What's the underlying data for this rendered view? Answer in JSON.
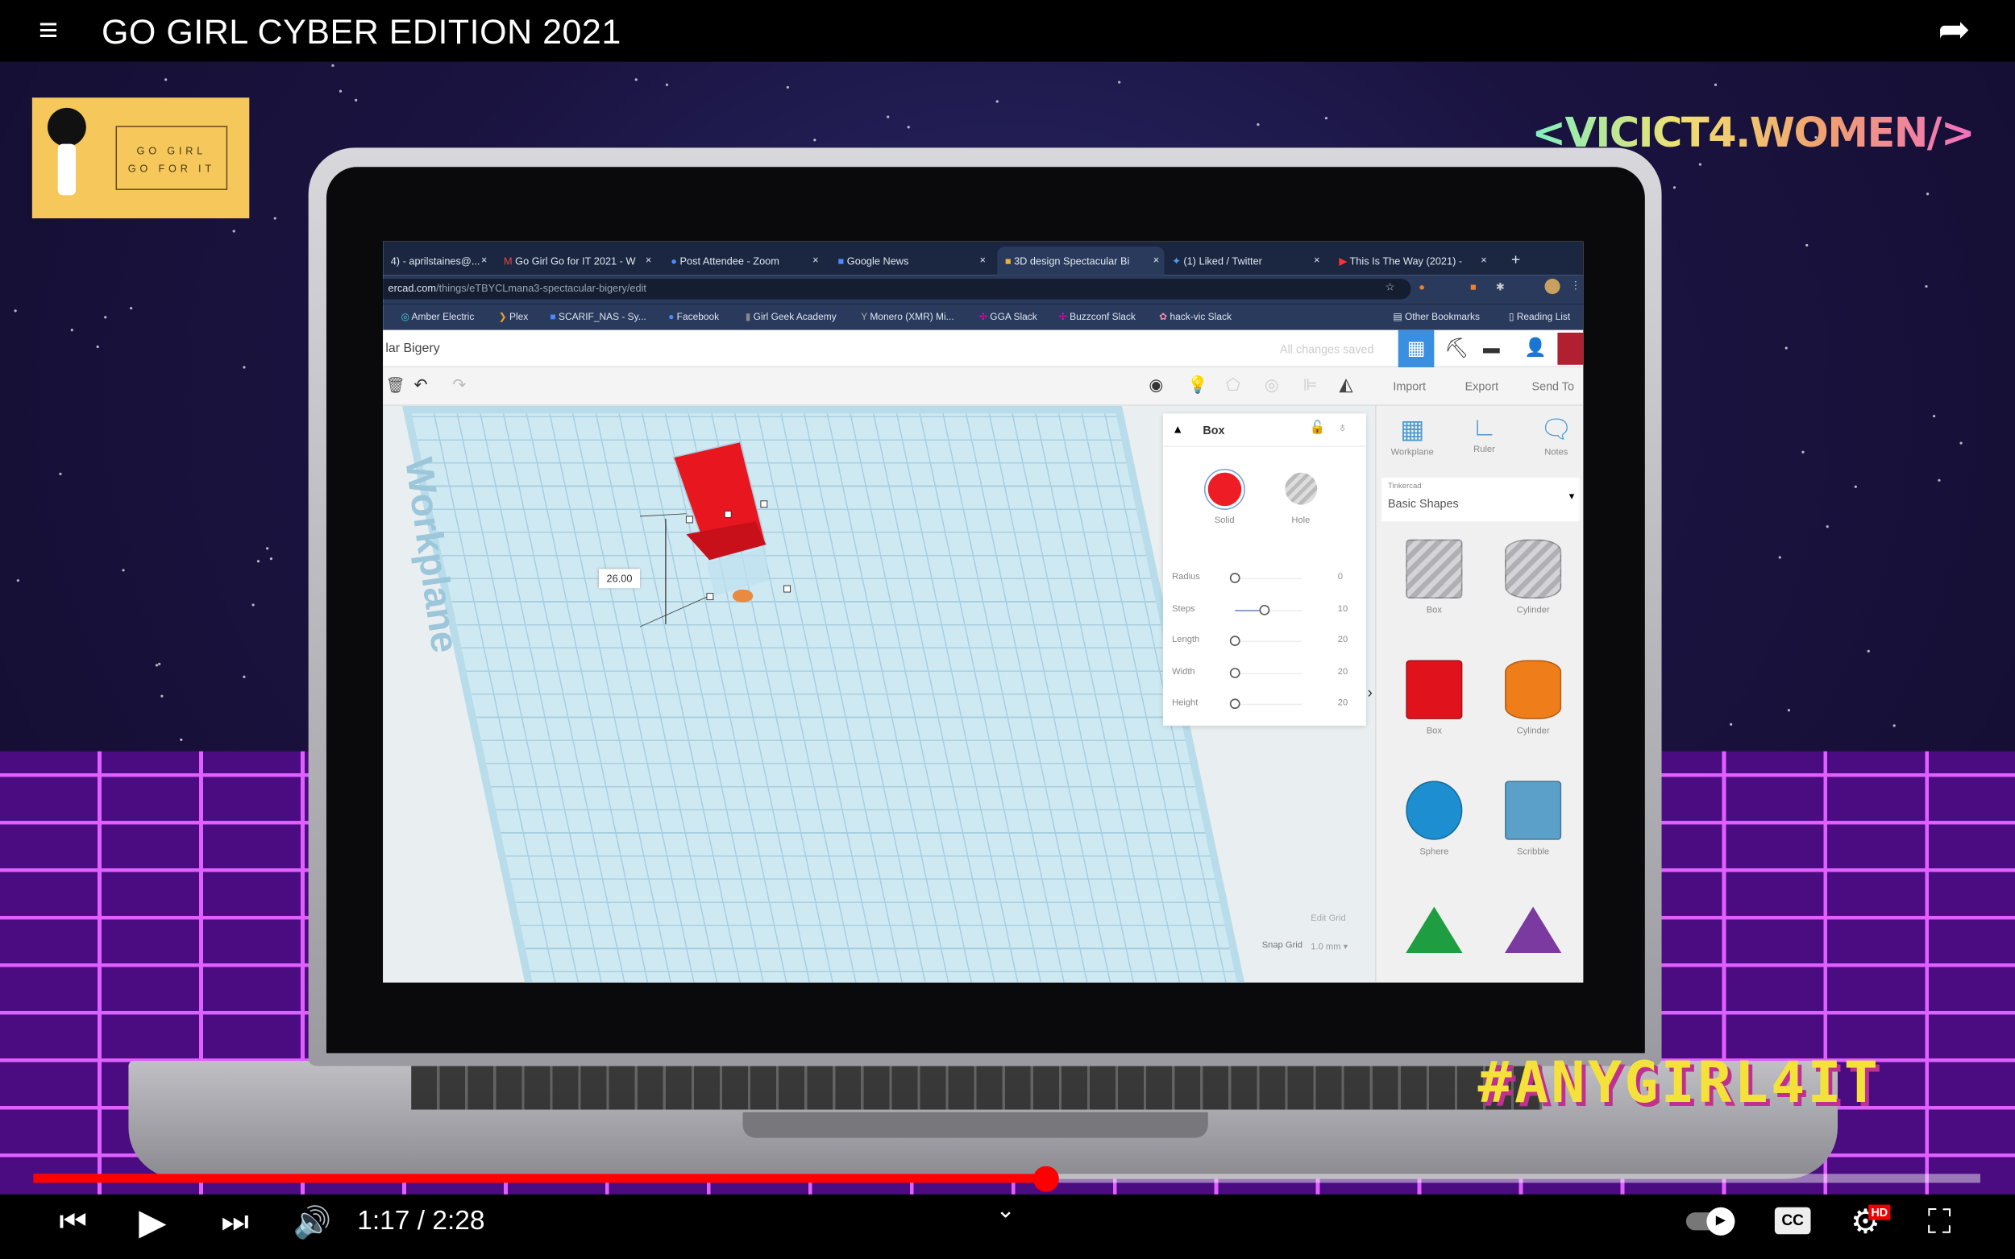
{
  "player": {
    "title": "GO GIRL CYBER EDITION 2021",
    "current_time": "1:17",
    "duration": "2:28",
    "time_display": "1:17 / 2:28",
    "progress_percent": 52,
    "hd_badge": "HD",
    "cc_label": "CC",
    "accent": "#ff0000",
    "icons": [
      "playlist-icon",
      "share-icon",
      "previous-icon",
      "play-icon",
      "next-icon",
      "volume-icon",
      "chevron-down-icon",
      "autoplay-toggle",
      "cc-icon",
      "settings-icon",
      "exit-fullscreen-icon"
    ]
  },
  "overlay": {
    "logo_line1": "GO GIRL",
    "logo_line2": "GO FOR IT",
    "brand": "<VICICT4.WOMEN/>",
    "hashtag": "#ANYGIRL4IT"
  },
  "browser": {
    "tabs": [
      {
        "label": "4) - aprilstaines@..."
      },
      {
        "label": "Go Girl Go for IT 2021 - W"
      },
      {
        "label": "Post Attendee - Zoom"
      },
      {
        "label": "Google News"
      },
      {
        "label": "3D design Spectacular Bi",
        "active": true
      },
      {
        "label": "(1) Liked / Twitter"
      },
      {
        "label": "This Is The Way (2021) -"
      }
    ],
    "url_host": "ercad.com",
    "url_path": "/things/eTBYCLmana3-spectacular-bigery/edit",
    "bookmarks": [
      "Amber Electric",
      "Plex",
      "SCARIF_NAS - Sy...",
      "Facebook",
      "Girl Geek Academy",
      "Monero (XMR) Mi...",
      "GGA Slack",
      "Buzzconf Slack",
      "hack-vic Slack"
    ],
    "other_bookmarks": "Other Bookmarks",
    "reading_list": "Reading List"
  },
  "tinkercad": {
    "design_name": "lar Bigery",
    "save_status": "All changes saved",
    "toolbar": {
      "import": "Import",
      "export": "Export",
      "send_to": "Send To"
    },
    "dimension_label": "26.00",
    "workplane_label": "Workplane",
    "inspector": {
      "shape_name": "Box",
      "solid": "Solid",
      "hole": "Hole",
      "solid_color": "#ee1c25",
      "params": [
        {
          "label": "Radius",
          "value": "0",
          "fraction": 0
        },
        {
          "label": "Steps",
          "value": "10",
          "fraction": 0.45
        },
        {
          "label": "Length",
          "value": "20",
          "fraction": 0
        },
        {
          "label": "Width",
          "value": "20",
          "fraction": 0
        },
        {
          "label": "Height",
          "value": "20",
          "fraction": 0
        }
      ]
    },
    "tools": [
      "Workplane",
      "Ruler",
      "Notes"
    ],
    "library_source": "Tinkercad",
    "library_name": "Basic Shapes",
    "shapes": [
      {
        "label": "Box",
        "color": "#b8b8bc"
      },
      {
        "label": "Cylinder",
        "color": "#b8b8bc"
      },
      {
        "label": "Box",
        "color": "#e0131d"
      },
      {
        "label": "Cylinder",
        "color": "#ef7d1a"
      },
      {
        "label": "Sphere",
        "color": "#1d8fd0"
      },
      {
        "label": "Scribble",
        "color": "#5aa0c8"
      },
      {
        "label": "",
        "color": "#1e9e40"
      },
      {
        "label": "",
        "color": "#7a3aa0"
      }
    ],
    "edit_grid": "Edit Grid",
    "snap_grid_label": "Snap Grid",
    "snap_grid_value": "1.0 mm"
  }
}
